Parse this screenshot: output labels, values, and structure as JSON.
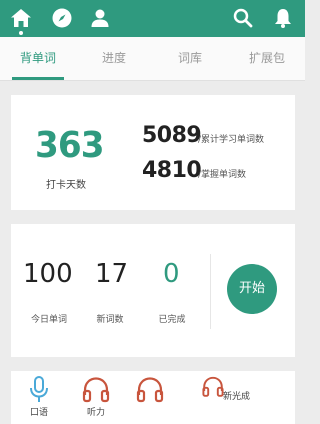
{
  "tabs": [
    {
      "label": "背单词"
    },
    {
      "label": "进度"
    },
    {
      "label": "词库"
    },
    {
      "label": "扩展包"
    }
  ],
  "summary": {
    "streak_value": "363",
    "streak_label": "打卡天数",
    "cumulative_value": "5089",
    "cumulative_label": "/累计学习单词数",
    "mastered_value": "4810",
    "mastered_label": "/掌握单词数"
  },
  "today": {
    "today_words_value": "100",
    "today_words_label": "今日单词",
    "new_words_value": "17",
    "new_words_label": "新词数",
    "done_value": "0",
    "done_label": "已完成",
    "start_label": "开始"
  },
  "tools": [
    {
      "label": "口语",
      "icon": "microphone-icon"
    },
    {
      "label": "听力",
      "icon": "headphones-icon"
    },
    {
      "label": "",
      "icon": "headphones-icon"
    },
    {
      "label": "新光成",
      "icon": "headphones-icon"
    }
  ],
  "colors": {
    "accent": "#2f9a7f"
  }
}
